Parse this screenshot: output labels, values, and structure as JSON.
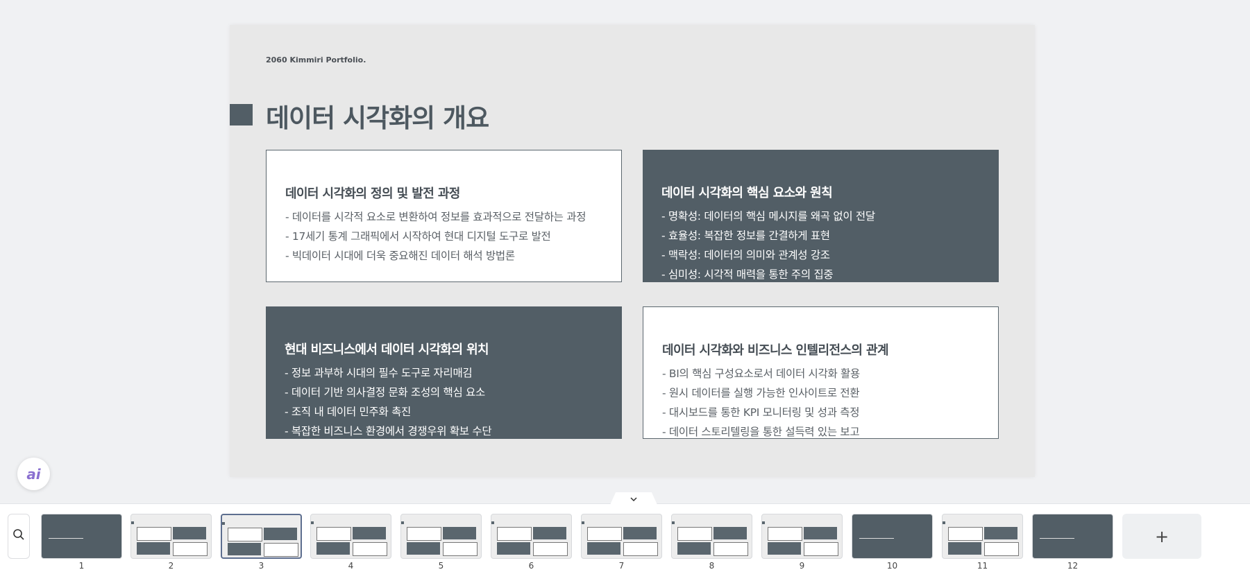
{
  "slide": {
    "brand": "2060 Kimmiri Portfolio.",
    "title": "데이터 시각화의 개요",
    "cards": [
      {
        "heading": "데이터 시각화의 정의 및 발전 과정",
        "style": "light",
        "items": [
          "- 데이터를 시각적 요소로 변환하여 정보를 효과적으로 전달하는 과정",
          "- 17세기 통계 그래픽에서 시작하여 현대 디지털 도구로 발전",
          "- 빅데이터 시대에 더욱 중요해진 데이터 해석 방법론"
        ]
      },
      {
        "heading": "데이터 시각화의 핵심 요소와 원칙",
        "style": "dark",
        "items": [
          "- 명확성: 데이터의 핵심 메시지를 왜곡 없이 전달",
          "- 효율성: 복잡한 정보를 간결하게 표현",
          "- 맥락성: 데이터의 의미와 관계성 강조",
          "- 심미성: 시각적 매력을 통한 주의 집중"
        ]
      },
      {
        "heading": "현대 비즈니스에서 데이터 시각화의 위치",
        "style": "dark",
        "items": [
          "- 정보 과부하 시대의 필수 도구로 자리매김",
          "- 데이터 기반 의사결정 문화 조성의 핵심 요소",
          "- 조직 내 데이터 민주화 촉진",
          "- 복잡한 비즈니스 환경에서 경쟁우위 확보 수단"
        ]
      },
      {
        "heading": "데이터 시각화와 비즈니스 인텔리전스의 관계",
        "style": "light",
        "items": [
          "- BI의 핵심 구성요소로서 데이터 시각화 활용",
          "- 원시 데이터를 실행 가능한 인사이트로 전환",
          "- 대시보드를 통한 KPI 모니터링 및 성과 측정",
          "- 데이터 스토리텔링을 통한 설득력 있는 보고"
        ]
      }
    ]
  },
  "ui": {
    "ai_button": "ai",
    "collapse_icon": "chevron-down-icon",
    "zoom_icon": "zoom-icon",
    "add_slide_label": "+"
  },
  "thumbnails": [
    {
      "num": "1",
      "style": "dark",
      "active": false
    },
    {
      "num": "2",
      "style": "light",
      "active": false
    },
    {
      "num": "3",
      "style": "light",
      "active": true
    },
    {
      "num": "4",
      "style": "light",
      "active": false
    },
    {
      "num": "5",
      "style": "light",
      "active": false
    },
    {
      "num": "6",
      "style": "light",
      "active": false
    },
    {
      "num": "7",
      "style": "light",
      "active": false
    },
    {
      "num": "8",
      "style": "light",
      "active": false
    },
    {
      "num": "9",
      "style": "light",
      "active": false
    },
    {
      "num": "10",
      "style": "dark",
      "active": false
    },
    {
      "num": "11",
      "style": "light",
      "active": false
    },
    {
      "num": "12",
      "style": "dark",
      "active": false
    }
  ],
  "colors": {
    "accent": "#525e66",
    "background": "#f0f1f3",
    "slide": "#e8e8e8"
  }
}
